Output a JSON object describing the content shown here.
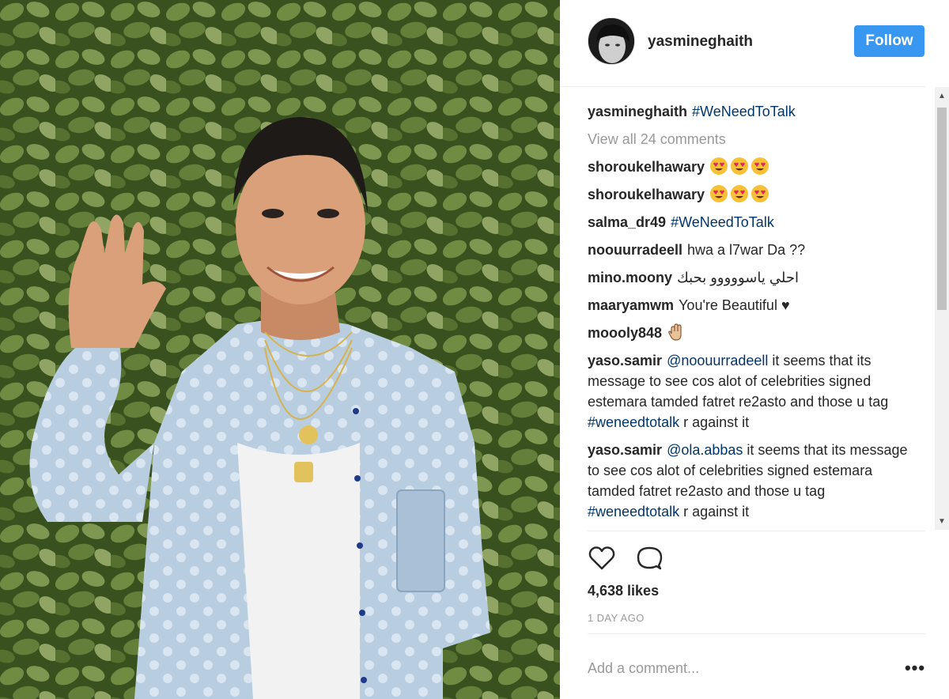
{
  "post": {
    "author": "yasmineghaith",
    "follow_label": "Follow",
    "photo_icon": "person-waving-photo",
    "caption": {
      "user": "yasmineghaith",
      "hashtag": "#WeNeedToTalk"
    },
    "view_all": "View all 24 comments",
    "likes": "4,638 likes",
    "time_ago": "1 DAY AGO",
    "add_comment_placeholder": "Add a comment...",
    "more_label": "•••"
  },
  "comments": [
    {
      "user": "shoroukelhawary",
      "emojis": [
        "heart-eyes-emoji",
        "heart-eyes-emoji",
        "heart-eyes-emoji"
      ]
    },
    {
      "user": "shoroukelhawary",
      "emojis": [
        "heart-eyes-emoji",
        "heart-eyes-emoji",
        "heart-eyes-emoji"
      ]
    },
    {
      "user": "salma_dr49",
      "hashtag": "#WeNeedToTalk"
    },
    {
      "user": "noouurradeell",
      "text": "hwa a l7war Da ??"
    },
    {
      "user": "mino.moony",
      "text": "احلي ياسووووو بحبك"
    },
    {
      "user": "maaryamwm",
      "text": "You're Beautiful ♥"
    },
    {
      "user": "moooly848",
      "emojis": [
        "raised-hand-emoji"
      ]
    },
    {
      "user": "yaso.samir",
      "mention": "@noouurradeell",
      "text": " it seems that its message to see cos alot of celebrities signed estemara tamded fatret re2asto and those u tag ",
      "hashtag": "#weneedtotalk",
      "text_after": " r against it"
    },
    {
      "user": "yaso.samir",
      "mention": "@ola.abbas",
      "text": " it seems that its message to see cos alot of celebrities signed estemara tamded fatret re2asto and those u tag ",
      "hashtag": "#weneedtotalk",
      "text_after": " r against it"
    }
  ],
  "colors": {
    "follow_button": "#3897f0",
    "hashtag": "#003569",
    "muted": "#999999"
  }
}
